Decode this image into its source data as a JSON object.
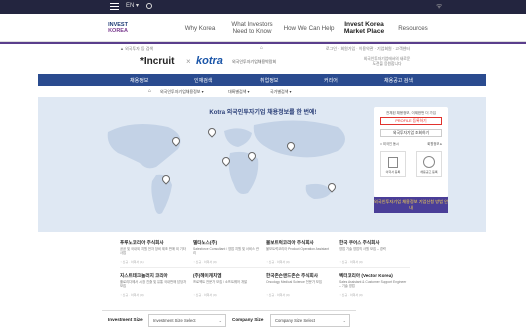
{
  "topbar": {
    "lang": "EN ▾",
    "rss_icon": "rss-icon"
  },
  "nav": {
    "logo_line1": "INVEST",
    "logo_line2": "KOREA",
    "items": [
      {
        "label": "Why Korea"
      },
      {
        "label": "What Investors Need to Know"
      },
      {
        "label": "How We Can Help"
      },
      {
        "label": "Invest Korea Market Place"
      },
      {
        "label": "Resources"
      }
    ]
  },
  "crumb": {
    "left": "▲ 외국투자 등 검색",
    "right": "로그인 · 회원가입 · 이용약관 · 기업회원 · 고객센터"
  },
  "brand": {
    "incruit_prefix": "*Incruit",
    "sep": "×",
    "kotra": "kotra",
    "subtitle": "외국인투자기업채용박람회",
    "right": "외국인투자기업에서의 새로운 도전을 응원합니다"
  },
  "bluebar": {
    "items": [
      "채용정보",
      "인재검색",
      "취업정보",
      "커리어",
      "채용공고 검색"
    ]
  },
  "filter": {
    "home_icon": "home-icon",
    "items": [
      "외국인투자기업채용정보 ▾",
      "대륙별검색 ▾",
      "국가별검색 ▾"
    ]
  },
  "map": {
    "title": "Kotra 외국인투자기업 채용정보를 한 번에!",
    "pins": [
      {
        "label": "North America"
      },
      {
        "label": "Europe"
      },
      {
        "label": "Asia"
      },
      {
        "label": "South America"
      },
      {
        "label": "Africa"
      },
      {
        "label": "Oceania"
      },
      {
        "label": "Middle East"
      }
    ]
  },
  "panel": {
    "info": "전체된 채용정보, 이제한번 더 가입",
    "primary_btn": "PROFILE 등록하기",
    "secondary_btn": "외국투자기업 조회하기",
    "check_a": "□ 외국인 동시",
    "check_b": "회원정보 ▸",
    "icon1": "이력서 등록",
    "icon2": "채용공고 등록",
    "apply": "외국인투자기업 채용정보 기업신청 방법 안내"
  },
  "cards": [
    {
      "title": "푸루노코리아 주식회사",
      "desc": "공공 및 국내외 지원 전자 장비 제조 판매 외 기타 사업",
      "meta": "◔ 신규 · 이력서 (1)"
    },
    {
      "title": "델타노스(주)",
      "desc": "Salesforce Consultant / 영업 지원 및 서비스 관리",
      "meta": "◔ 신규 · 이력서 (0)"
    },
    {
      "title": "볼보트럭코리아 주식회사",
      "desc": "볼보트럭코리아 Product Operation Assistant",
      "meta": "◔ 신규 · 이력서 (0)"
    },
    {
      "title": "한국 쿠어스 주식회사",
      "desc": "영업 기술 영업직 사원 모집 – 경력",
      "meta": "◔ 신규 · 이력서 (0)"
    },
    {
      "title": "지스트테크놀러지 코리아",
      "desc": "플로리다에서 시장 진출 및 유통 국내판매 담당자 모집",
      "meta": "◔ 신규 · 이력서 (0)"
    },
    {
      "title": "(주)헤이캐치엠",
      "desc": "프로젝트 전문가 모집 / 소프트웨어 개발",
      "meta": "◔ 신규 · 이력서 (0)"
    },
    {
      "title": "한국존슨앤드존슨 주식회사",
      "desc": "Oncology Medical Science 전문가 모집",
      "meta": "◔ 신규 · 이력서 (0)"
    },
    {
      "title": "벡터코리아 (Vector Korea)",
      "desc": "Sales Assistant & Customer Support Engineer – 기술 영업",
      "meta": "◔ 신규 · 이력서 (0)"
    }
  ],
  "bottom": {
    "investment_label": "Investment Size",
    "investment_placeholder": "Investment Size Select",
    "company_label": "Company Size",
    "company_placeholder": "Company Size Select"
  }
}
